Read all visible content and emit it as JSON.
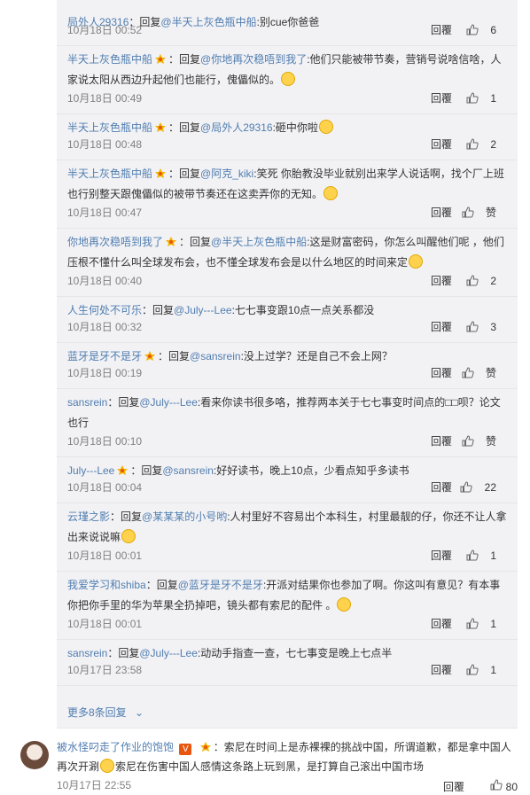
{
  "replies": [
    {
      "user": "局外人29316",
      "badge": false,
      "sep": "：回复",
      "mention": "@半天上灰色瓶中船",
      "text": ":别cue你爸爸",
      "time": "10月18日 00:52",
      "reply_label": "回覆",
      "likes": "6"
    },
    {
      "user": "半天上灰色瓶中船",
      "badge": true,
      "sep": "：回复",
      "mention": "@你地再次稳唔到我了",
      "text": ":他们只能被带节奏，营销号说啥信啥，人家说太阳从西边升起他们也能行，傀儡似的。",
      "time": "10月18日 00:49",
      "reply_label": "回覆",
      "likes": "1"
    },
    {
      "user": "半天上灰色瓶中船",
      "badge": true,
      "sep": "：回复",
      "mention": "@局外人29316",
      "text": ":砸中你啦",
      "time": "10月18日 00:48",
      "reply_label": "回覆",
      "likes": "2"
    },
    {
      "user": "半天上灰色瓶中船",
      "badge": true,
      "sep": "：回复",
      "mention": "@阿克_kiki",
      "text": ":笑死 你胎教没毕业就别出来学人说话啊，找个厂上班也行别整天跟傀儡似的被带节奏还在这卖弄你的无知。",
      "time": "10月18日 00:47",
      "reply_label": "回覆",
      "likes": "赞"
    },
    {
      "user": "你地再次稳唔到我了",
      "badge": true,
      "sep": "：回复",
      "mention": "@半天上灰色瓶中船",
      "text": ":这是财富密码，你怎么叫醒他们呢 ，他们压根不懂什么叫全球发布会，也不懂全球发布会是以什么地区的时间来定",
      "time": "10月18日 00:40",
      "reply_label": "回覆",
      "likes": "2"
    },
    {
      "user": "人生何处不可乐",
      "badge": false,
      "sep": "：回复",
      "mention": "@July---Lee",
      "text": ":七七事变跟10点一点关系都没",
      "time": "10月18日 00:32",
      "reply_label": "回覆",
      "likes": "3"
    },
    {
      "user": "蓝牙是牙不是牙",
      "badge": true,
      "sep": "：回复",
      "mention": "@sansrein",
      "text": ":没上过学？还是自己不会上网？",
      "time": "10月18日 00:19",
      "reply_label": "回覆",
      "likes": "赞"
    },
    {
      "user": "sansrein",
      "badge": false,
      "sep": "：回复",
      "mention": "@July---Lee",
      "text": ":看来你读书很多咯，推荐两本关于七七事变时间点的□□呗？论文也行",
      "time": "10月18日 00:10",
      "reply_label": "回覆",
      "likes": "赞"
    },
    {
      "user": "July---Lee",
      "badge": true,
      "sep": "：回复",
      "mention": "@sansrein",
      "text": ":好好读书，晚上10点，少看点知乎多读书",
      "time": "10月18日 00:04",
      "reply_label": "回覆",
      "likes": "22"
    },
    {
      "user": "云瑾之影",
      "badge": false,
      "sep": "：回复",
      "mention": "@某某某的小号哟",
      "text": ":人村里好不容易出个本科生，村里最靓的仔，你还不让人拿出来说说嘛",
      "time": "10月18日 00:01",
      "reply_label": "回覆",
      "likes": "1"
    },
    {
      "user": "我爱学习和shiba",
      "badge": false,
      "sep": "：回复",
      "mention": "@蓝牙是牙不是牙",
      "text": ":开派对结果你也参加了啊。你这叫有意见？有本事你把你手里的华为苹果全扔掉吧，镜头都有索尼的配件 。",
      "time": "10月18日 00:01",
      "reply_label": "回覆",
      "likes": "1"
    },
    {
      "user": "sansrein",
      "badge": false,
      "sep": "：回复",
      "mention": "@July---Lee",
      "text": ":动动手指查一查，七七事变是晚上七点半",
      "time": "10月17日 23:58",
      "reply_label": "回覆",
      "likes": "1"
    }
  ],
  "more_replies": "更多8条回复",
  "main": {
    "user": "被水怪叼走了作业的饱饱",
    "vip": "V",
    "text_a": "：索尼在时间上是赤裸裸的挑战中国，所谓道歉，都是拿中国人再次开涮",
    "text_b": "索尼在伤害中国人感情这条路上玩到黑，是打算自己滚出中国市场",
    "time": "10月17日 22:55",
    "reply_label": "回覆",
    "likes": "80"
  }
}
